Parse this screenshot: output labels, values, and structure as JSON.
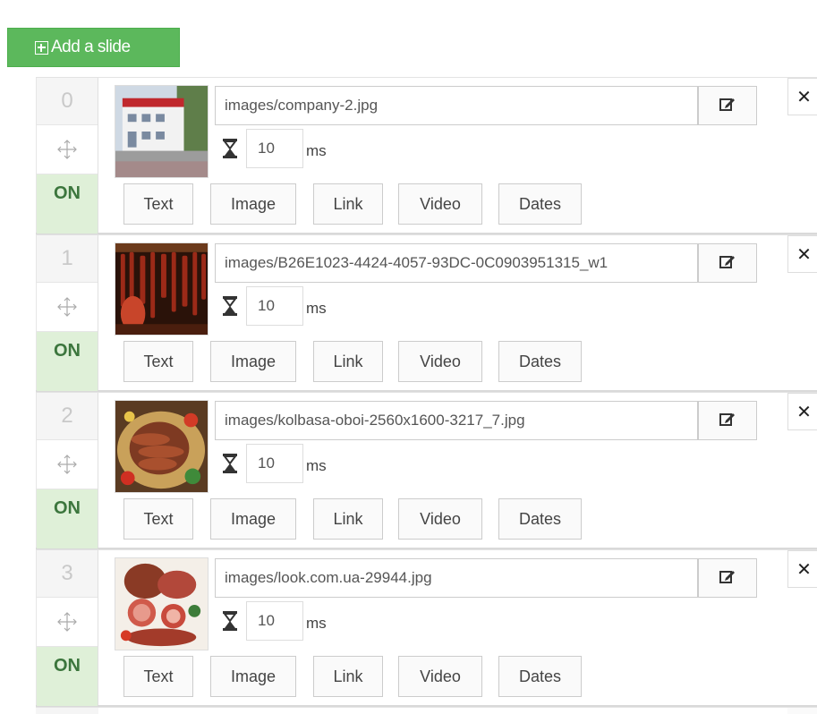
{
  "toolbar": {
    "add_label": "Add a slide"
  },
  "slides": [
    {
      "index": "0",
      "path": "images/company-2.jpg",
      "delay": "10",
      "unit": "ms",
      "status": "ON",
      "tabs": [
        "Text",
        "Image",
        "Link",
        "Video",
        "Dates"
      ],
      "thumbnail": "building-photo"
    },
    {
      "index": "1",
      "path": "images/B26E1023-4424-4057-93DC-0C0903951315_w1",
      "delay": "10",
      "unit": "ms",
      "status": "ON",
      "tabs": [
        "Text",
        "Image",
        "Link",
        "Video",
        "Dates"
      ],
      "thumbnail": "hanging-sausages-photo"
    },
    {
      "index": "2",
      "path": "images/kolbasa-oboi-2560x1600-3217_7.jpg",
      "delay": "10",
      "unit": "ms",
      "status": "ON",
      "tabs": [
        "Text",
        "Image",
        "Link",
        "Video",
        "Dates"
      ],
      "thumbnail": "sausage-plate-photo"
    },
    {
      "index": "3",
      "path": "images/look.com.ua-29944.jpg",
      "delay": "10",
      "unit": "ms",
      "status": "ON",
      "tabs": [
        "Text",
        "Image",
        "Link",
        "Video",
        "Dates"
      ],
      "thumbnail": "meat-platter-photo"
    }
  ],
  "colors": {
    "add_button": "#5cb85c",
    "on_background": "#dff0d8",
    "on_text": "#3c763d"
  },
  "icons": {
    "move": "move-arrows-icon",
    "edit": "edit-icon",
    "close": "close-icon",
    "delay": "hourglass-icon",
    "add": "plus-square-icon"
  }
}
